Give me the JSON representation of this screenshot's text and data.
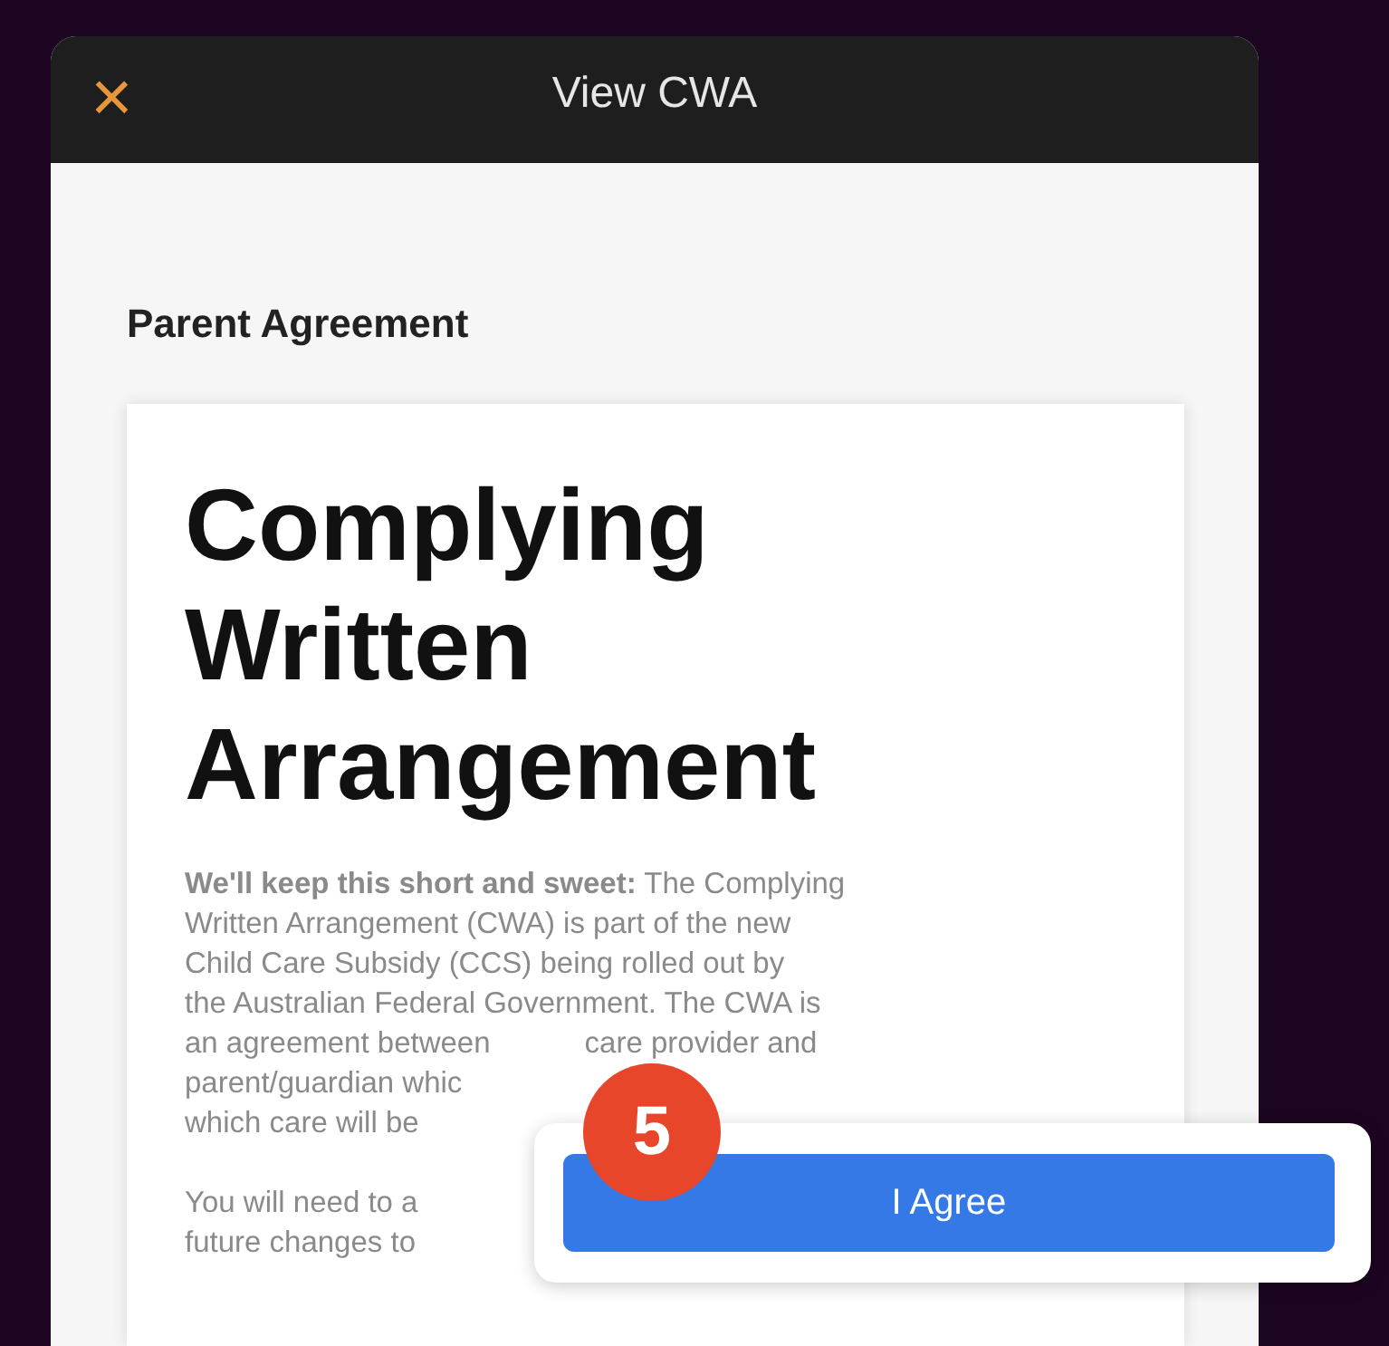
{
  "header": {
    "close_icon": "×",
    "title": "View CWA"
  },
  "section_title": "Parent Agreement",
  "document": {
    "heading": [
      "Complying",
      "Written",
      "Arrangement"
    ],
    "paragraphs": [
      {
        "lines": [
          [
            "**We'll keep this short and sweet:** The Complying"
          ],
          [
            "Written Arrangement (CWA) is part of the new"
          ],
          [
            "Child Care Subsidy (CCS) being rolled out by"
          ],
          [
            "the Australian Federal Government. The CWA is"
          ],
          [
            "an agreement between",
            "care provider and"
          ],
          [
            "parent/guardian whic"
          ],
          [
            "which care will be"
          ]
        ]
      },
      {
        "lines": [
          [
            "You will need to a"
          ],
          [
            "future changes to"
          ]
        ]
      }
    ]
  },
  "overlay": {
    "step_badge": "5",
    "button": "I Agree"
  }
}
